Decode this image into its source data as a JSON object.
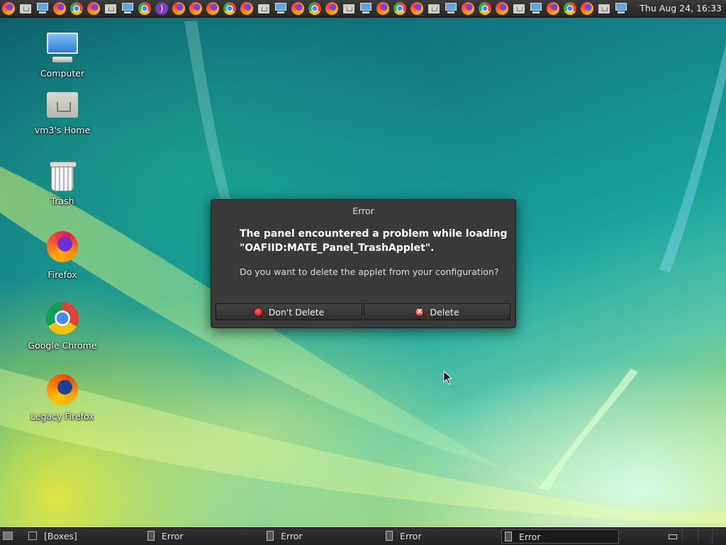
{
  "top_panel": {
    "launchers": [
      "firefox-icon",
      "home-folder-icon",
      "computer-icon",
      "firefox-icon",
      "chrome-icon",
      "firefox-icon",
      "home-folder-icon",
      "computer-icon",
      "chrome-icon",
      "tor-icon",
      "firefox-icon",
      "firefox-icon",
      "firefox-icon",
      "chrome-icon",
      "firefox-icon",
      "home-folder-icon",
      "computer-icon",
      "firefox-icon",
      "chrome-icon",
      "firefox-icon",
      "home-folder-icon",
      "computer-icon",
      "firefox-icon",
      "chrome-icon",
      "firefox-icon",
      "home-folder-icon",
      "computer-icon",
      "firefox-icon",
      "chrome-icon",
      "firefox-icon",
      "home-folder-icon",
      "computer-icon",
      "firefox-icon",
      "chrome-icon",
      "firefox-icon",
      "home-folder-icon",
      "computer-icon"
    ],
    "clock": "Thu Aug 24, 16:33"
  },
  "desktop": {
    "icons": [
      {
        "label": "Computer"
      },
      {
        "label": "vm3's Home"
      },
      {
        "label": "Trash"
      },
      {
        "label": "Firefox"
      },
      {
        "label": "Google Chrome"
      },
      {
        "label": "Legacy Firefox"
      }
    ]
  },
  "dialog": {
    "title": "Error",
    "heading": "The panel encountered a problem while loading\n\"OAFIID:MATE_Panel_TrashApplet\".",
    "question": "Do you want to delete the applet from your configuration?",
    "dont_delete_label": "Don't Delete",
    "delete_label": "Delete"
  },
  "bottom_panel": {
    "tasks": [
      {
        "label": "[Boxes]"
      },
      {
        "label": "Error"
      },
      {
        "label": "Error"
      },
      {
        "label": "Error"
      },
      {
        "label": "Error"
      }
    ]
  }
}
